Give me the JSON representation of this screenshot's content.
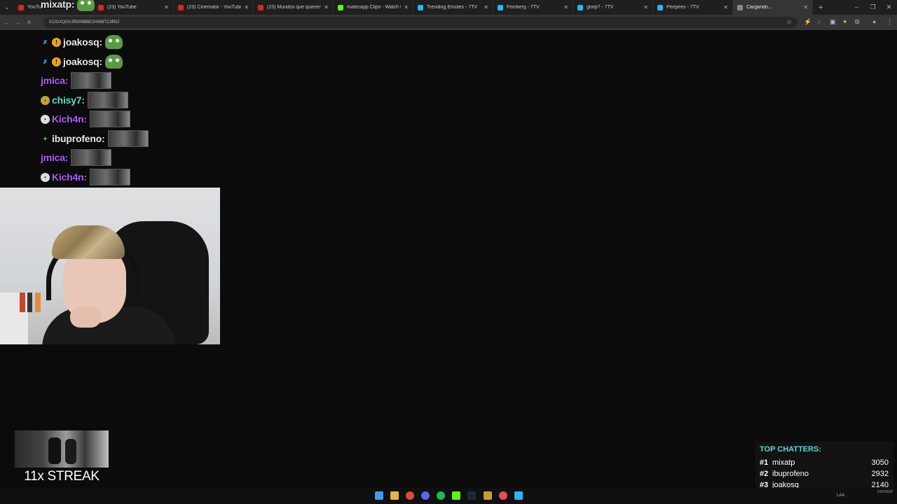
{
  "browser": {
    "tabs": [
      {
        "title": "YouTube",
        "favicon": "youtube-icon",
        "color": "#e62117"
      },
      {
        "title": "(23) YouTube",
        "favicon": "youtube-icon",
        "color": "#e62117"
      },
      {
        "title": "(23) Cinematix - YouTube",
        "favicon": "youtube-icon",
        "color": "#e62117"
      },
      {
        "title": "(23) Mundos que quieren ma",
        "favicon": "youtube-icon",
        "color": "#e62117"
      },
      {
        "title": "matecapp Clips - Watch Live c",
        "favicon": "kick-icon",
        "color": "#53fc18"
      },
      {
        "title": "Trending Emotes - 7TV",
        "favicon": "7tv-icon",
        "color": "#29b6f6"
      },
      {
        "title": "Feinberg - 7TV",
        "favicon": "7tv-icon",
        "color": "#29b6f6"
      },
      {
        "title": "glorp7 - 7TV",
        "favicon": "7tv-icon",
        "color": "#29b6f6"
      },
      {
        "title": "Peepees - 7TV",
        "favicon": "7tv-icon",
        "color": "#29b6f6"
      },
      {
        "title": "Cargando...",
        "favicon": "loading-icon",
        "color": "#888888",
        "active": true
      }
    ],
    "url": "01JGXQGVJR000BBE2HWBTC3R0J"
  },
  "chat": {
    "messages": [
      {
        "user": "mixatp:",
        "color": "#e9e9e9",
        "badge": "none",
        "emote": "pepe"
      },
      {
        "user": "joakosq:",
        "color": "#e9e9e9",
        "badge": "sword+orange",
        "emote": "pepe"
      },
      {
        "user": "joakosq:",
        "color": "#e9e9e9",
        "badge": "sword+orange",
        "emote": "pepe"
      },
      {
        "user": "jmica:",
        "color": "#b05bff",
        "badge": "none",
        "emote": "clip"
      },
      {
        "user": "chisy7:",
        "color": "#5fe0c8",
        "badge": "smiley",
        "emote": "clip"
      },
      {
        "user": "Kich4n:",
        "color": "#b05bff",
        "badge": "cat",
        "emote": "clip"
      },
      {
        "user": "ibuprofeno:",
        "color": "#e9e9e9",
        "badge": "green-star",
        "emote": "clip"
      },
      {
        "user": "jmica:",
        "color": "#b05bff",
        "badge": "none",
        "emote": "clip"
      },
      {
        "user": "Kich4n:",
        "color": "#b05bff",
        "badge": "cat",
        "emote": "clip"
      }
    ]
  },
  "streak": {
    "text": "11x STREAK"
  },
  "top_chatters": {
    "title": "TOP CHATTERS:",
    "rows": [
      {
        "rank": "#1",
        "name": "mixatp",
        "count": "3050"
      },
      {
        "rank": "#2",
        "name": "ibuprofeno",
        "count": "2932"
      },
      {
        "rank": "#3",
        "name": "joakosq",
        "count": "2140"
      }
    ]
  },
  "taskbar": {
    "lang": "LAA",
    "date": "24/5/2026"
  }
}
